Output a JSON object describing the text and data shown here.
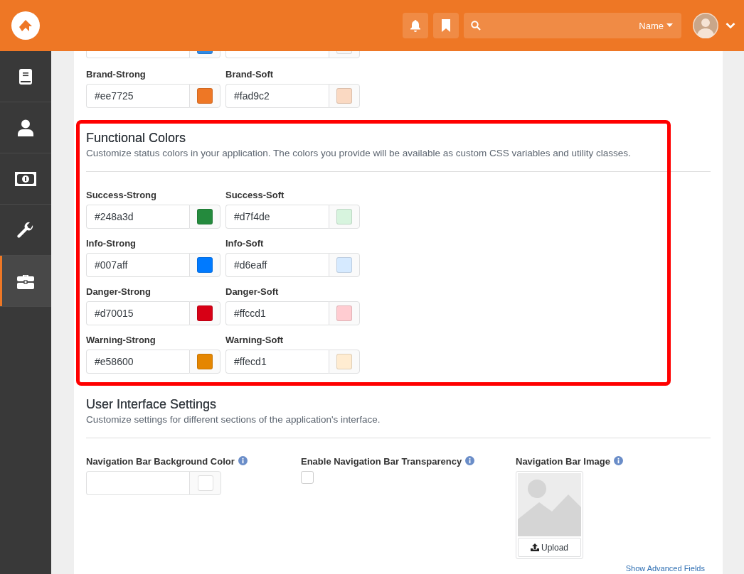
{
  "header": {
    "search": {
      "filter": "Name"
    }
  },
  "sidebar": {
    "items": [
      {
        "selected": false
      },
      {
        "selected": false
      },
      {
        "selected": false
      },
      {
        "selected": false
      },
      {
        "selected": true
      }
    ]
  },
  "fields_above": [
    {
      "color": "#2e8ae6"
    },
    {
      "color": "#f6f6f6"
    }
  ],
  "brand_colors": [
    {
      "label": "Brand-Strong",
      "value": "#ee7725",
      "color": "#ee7725"
    },
    {
      "label": "Brand-Soft",
      "value": "#fad9c2",
      "color": "#fad9c2"
    }
  ],
  "functional_colors": {
    "title": "Functional Colors",
    "description": "Customize status colors in your application. The colors you provide will be available as custom CSS variables and utility classes.",
    "highlighted": true,
    "fields": [
      {
        "label": "Success-Strong",
        "value": "#248a3d",
        "color": "#248a3d"
      },
      {
        "label": "Success-Soft",
        "value": "#d7f4de",
        "color": "#d7f4de"
      },
      {
        "label": "Info-Strong",
        "value": "#007aff",
        "color": "#007aff"
      },
      {
        "label": "Info-Soft",
        "value": "#d6eaff",
        "color": "#d6eaff"
      },
      {
        "label": "Danger-Strong",
        "value": "#d70015",
        "color": "#d70015"
      },
      {
        "label": "Danger-Soft",
        "value": "#ffccd1",
        "color": "#ffccd1"
      },
      {
        "label": "Warning-Strong",
        "value": "#e58600",
        "color": "#e58600"
      },
      {
        "label": "Warning-Soft",
        "value": "#ffecd1",
        "color": "#ffecd1"
      }
    ]
  },
  "user_interface_settings": {
    "title": "User Interface Settings",
    "description": "Customize settings for different sections of the application's interface.",
    "fields": [
      {
        "kind": "color",
        "label": "Navigation Bar Background Color",
        "color": "#ffffff"
      },
      {
        "kind": "checkbox",
        "label": "Enable Navigation Bar Transparency",
        "checked": false
      },
      {
        "kind": "image",
        "label": "Navigation Bar Image",
        "button": "Upload"
      }
    ]
  },
  "show_advanced_fields": "Show Advanced Fields"
}
